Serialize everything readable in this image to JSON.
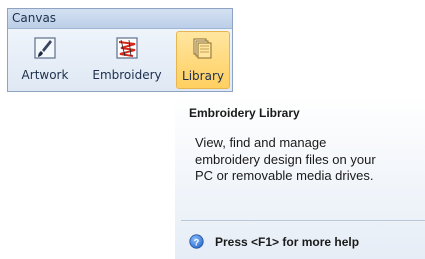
{
  "toolbar": {
    "title": "Canvas",
    "tools": [
      {
        "label": "Artwork",
        "icon": "artwork-brush-icon"
      },
      {
        "label": "Embroidery",
        "icon": "embroidery-stitch-icon"
      },
      {
        "label": "Library",
        "icon": "library-folder-icon",
        "selected": true
      }
    ]
  },
  "tooltip": {
    "title": "Embroidery Library",
    "description": "View, find and manage embroidery design files on your PC or removable media drives.",
    "help_text": "Press <F1> for more help",
    "help_icon": "help-icon"
  },
  "colors": {
    "selected_fill": "#ffcf60",
    "toolbar_border": "#8da3c1",
    "help_icon": "#2f6fd0"
  }
}
